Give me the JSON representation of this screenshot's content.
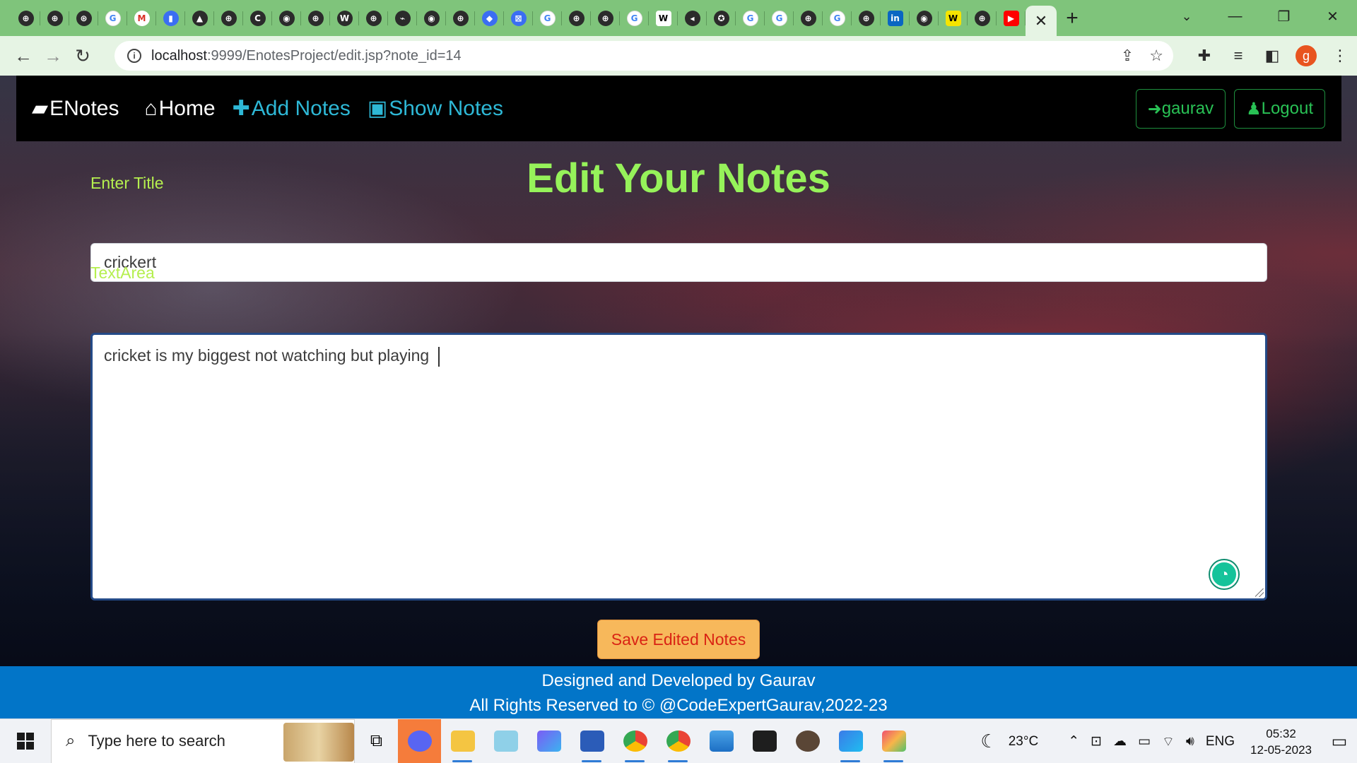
{
  "browser": {
    "tab_favicons": [
      "globe",
      "globe",
      "openai",
      "google",
      "gmail",
      "docs",
      "drive",
      "globe",
      "cpp",
      "github",
      "globe",
      "wordpress",
      "globe",
      "leetcode",
      "github",
      "globe",
      "gemini",
      "translate",
      "google",
      "globe",
      "globe",
      "google",
      "wikipedia",
      "audio",
      "star",
      "google",
      "google",
      "globe",
      "google",
      "globe",
      "linkedin",
      "github",
      "wix",
      "globe",
      "youtube"
    ],
    "tab_favicon_letters": [
      "⊕",
      "⊕",
      "⊛",
      "G",
      "M",
      "▮",
      "▲",
      "⊕",
      "C",
      "◉",
      "⊕",
      "W",
      "⊕",
      "⌁",
      "◉",
      "⊕",
      "◆",
      "⊠",
      "G",
      "⊕",
      "⊕",
      "G",
      "W",
      "◂",
      "✪",
      "G",
      "G",
      "⊕",
      "G",
      "⊕",
      "in",
      "◉",
      "W",
      "⊕",
      "▶"
    ],
    "active_tab_close": "✕",
    "new_tab": "+",
    "url_host": "localhost",
    "url_rest": ":9999/EnotesProject/edit.jsp?note_id=14",
    "profile_initial": "g",
    "accent_color": "#7fc47b"
  },
  "navbar": {
    "brand": "ENotes",
    "home": "Home",
    "add_notes": "Add Notes",
    "show_notes": "Show Notes",
    "user_button": "gaurav",
    "logout_button": "Logout"
  },
  "form": {
    "heading": "Edit Your Notes",
    "title_label": "Enter Title",
    "title_value": "crickert",
    "text_label": "TextArea",
    "text_value": "cricket is my biggest not watching but playing ",
    "submit": "Save Edited Notes"
  },
  "footer": {
    "line1": "Designed and Developed by Gaurav",
    "line2": "All Rights Reserved to © @CodeExpertGaurav,2022-23"
  },
  "taskbar": {
    "search_placeholder": "Type here to search",
    "weather": "23°C",
    "language": "ENG",
    "time": "05:32",
    "date": "12-05-2023",
    "apps": [
      "task-view",
      "discord",
      "file-explorer",
      "notepad",
      "copilot",
      "word",
      "chrome",
      "chrome-profile",
      "photos",
      "terminal",
      "git",
      "intellij",
      "sourcetree"
    ]
  }
}
